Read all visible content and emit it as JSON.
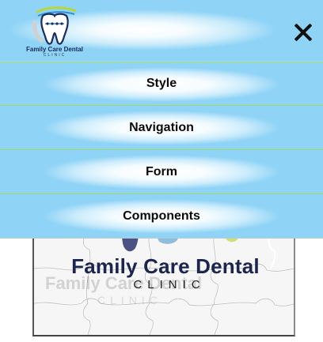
{
  "header": {
    "logo_name": "Family Care Dental",
    "logo_sub": "CLINIC",
    "close_label": "close menu"
  },
  "menu": {
    "items": [
      {
        "label": "Style"
      },
      {
        "label": "Navigation"
      },
      {
        "label": "Form"
      },
      {
        "label": "Components"
      }
    ]
  },
  "background": {
    "puzzle_title": "Family Care Dental",
    "puzzle_sub": "CLINIC",
    "puzzle_ghost_title": "Family Care Dental",
    "puzzle_ghost_sub": "CLINIC"
  },
  "colors": {
    "header_sky": "#8fd3f6",
    "menu_divider": "#9fd85e",
    "brand_navy": "#1b2a5e"
  },
  "icons": {
    "close": "close-icon",
    "logo": "tooth-icon"
  }
}
